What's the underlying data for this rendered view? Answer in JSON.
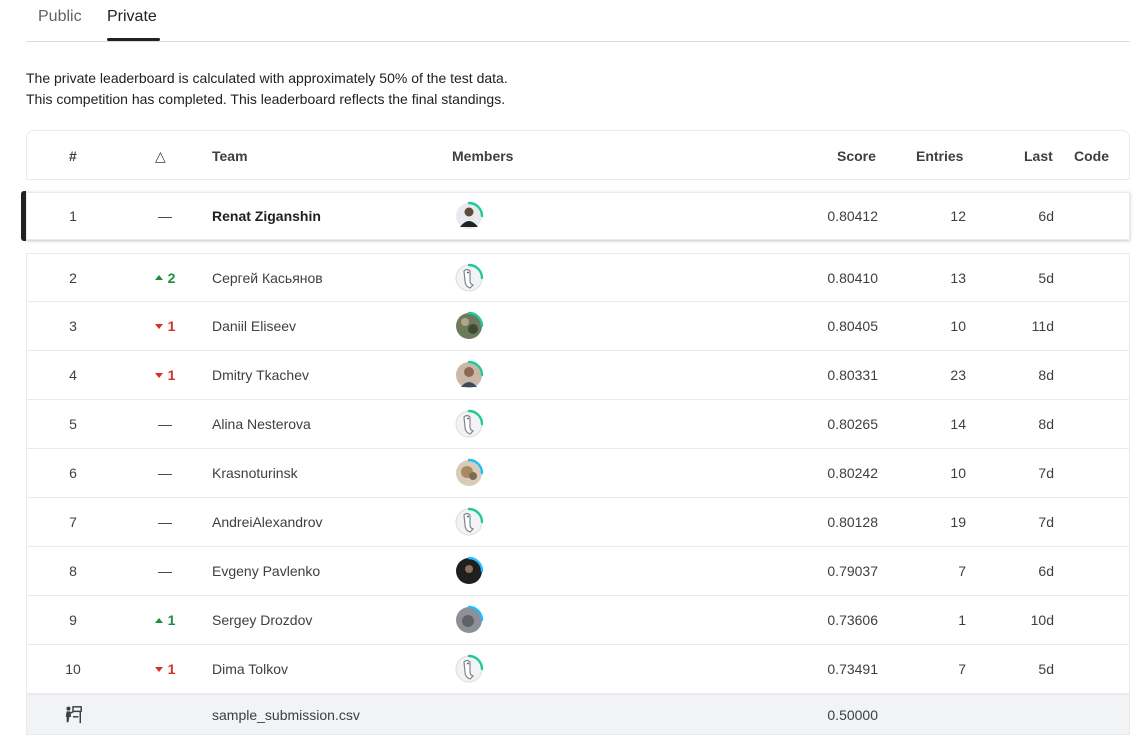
{
  "tabs": [
    {
      "label": "Public",
      "active": false
    },
    {
      "label": "Private",
      "active": true
    }
  ],
  "notice": {
    "line1": "The private leaderboard is calculated with approximately 50% of the test data.",
    "line2": "This competition has completed. This leaderboard reflects the final standings."
  },
  "columns": {
    "rank": "#",
    "delta": "△",
    "team": "Team",
    "members": "Members",
    "score": "Score",
    "entries": "Entries",
    "last": "Last",
    "code": "Code"
  },
  "rows": [
    {
      "rank": "1",
      "delta": "—",
      "team": "Renat Ziganshin",
      "score": "0.80412",
      "entries": "12",
      "last": "6d",
      "avatar": "photo-person-dark",
      "tier_color": "#20beff"
    },
    {
      "rank": "2",
      "delta": "2",
      "team": "Сергей Касьянов",
      "score": "0.80410",
      "entries": "13",
      "last": "5d",
      "avatar": "default-goose",
      "tier_color": "#20beff"
    },
    {
      "rank": "3",
      "delta": "1",
      "team": "Daniil Eliseev",
      "score": "0.80405",
      "entries": "10",
      "last": "11d",
      "avatar": "photo-outdoor",
      "tier_color": "#20beff"
    },
    {
      "rank": "4",
      "delta": "1",
      "team": "Dmitry Tkachev",
      "score": "0.80331",
      "entries": "23",
      "last": "8d",
      "avatar": "photo-person",
      "tier_color": "#20beff"
    },
    {
      "rank": "5",
      "delta": "—",
      "team": "Alina Nesterova",
      "score": "0.80265",
      "entries": "14",
      "last": "8d",
      "avatar": "default-goose",
      "tier_color": "#20beff"
    },
    {
      "rank": "6",
      "delta": "—",
      "team": "Krasnoturinsk",
      "score": "0.80242",
      "entries": "10",
      "last": "7d",
      "avatar": "photo-cat",
      "tier_color": "#20beff"
    },
    {
      "rank": "7",
      "delta": "—",
      "team": "AndreiAlexandrov",
      "score": "0.80128",
      "entries": "19",
      "last": "7d",
      "avatar": "default-goose",
      "tier_color": "#20beff"
    },
    {
      "rank": "8",
      "delta": "—",
      "team": "Evgeny Pavlenko",
      "score": "0.79037",
      "entries": "7",
      "last": "6d",
      "avatar": "photo-dark",
      "tier_color": "#20beff"
    },
    {
      "rank": "9",
      "delta": "1",
      "team": "Sergey Drozdov",
      "score": "0.73606",
      "entries": "1",
      "last": "10d",
      "avatar": "photo-grey",
      "tier_color": "#20beff"
    },
    {
      "rank": "10",
      "delta": "1",
      "team": "Dima Tolkov",
      "score": "0.73491",
      "entries": "7",
      "last": "5d",
      "avatar": "default-goose",
      "tier_color": "#20beff"
    }
  ],
  "baseline": {
    "icon": "benchmark-icon",
    "team": "sample_submission.csv",
    "score": "0.50000"
  }
}
